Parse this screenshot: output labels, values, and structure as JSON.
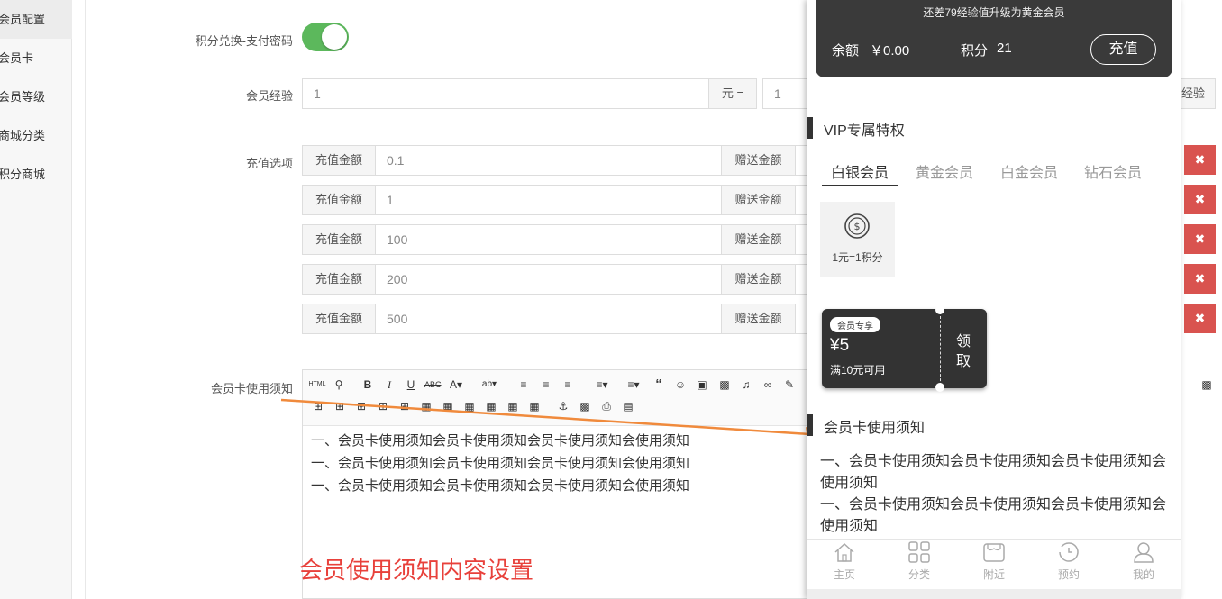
{
  "sidebar": {
    "items": [
      {
        "label": "会员配置",
        "active": true
      },
      {
        "label": "会员卡",
        "active": false
      },
      {
        "label": "会员等级",
        "active": false
      },
      {
        "label": "商城分类",
        "active": false
      },
      {
        "label": "积分商城",
        "active": false
      }
    ]
  },
  "form": {
    "points_pay_label": "积分兑换-支付密码",
    "points_pay_enabled": true,
    "exp_label": "会员经验",
    "exp_value": "1",
    "exp_unit": "元 =",
    "exp_value2": "1",
    "exp_suffix": "经验",
    "recharge_label": "充值选项",
    "recharge_rows": [
      {
        "amount_label": "充值金额",
        "amount": "0.1",
        "gift_label": "赠送金额"
      },
      {
        "amount_label": "充值金额",
        "amount": "1",
        "gift_label": "赠送金额"
      },
      {
        "amount_label": "充值金额",
        "amount": "100",
        "gift_label": "赠送金额"
      },
      {
        "amount_label": "充值金额",
        "amount": "200",
        "gift_label": "赠送金额"
      },
      {
        "amount_label": "充值金额",
        "amount": "500",
        "gift_label": "赠送金额"
      }
    ],
    "delete_glyph": "✖",
    "notice_label": "会员卡使用须知"
  },
  "editor": {
    "lines": [
      "一、会员卡使用须知会员卡使用须知会员卡使用须知会使用须知",
      "一、会员卡使用须知会员卡使用须知会员卡使用须知会使用须知",
      "一、会员卡使用须知会员卡使用须知会员卡使用须知会使用须知"
    ]
  },
  "annotation": {
    "text": "会员使用须知内容设置",
    "color": "#e8413b",
    "arrow_color": "#f08a3c"
  },
  "phone": {
    "upgrade_tip": "还差79经验值升级为黄金会员",
    "balance_label": "余额",
    "balance_value": "￥0.00",
    "points_label": "积分",
    "points_value": "21",
    "recharge_button": "充值",
    "vip_title": "VIP专属特权",
    "vip_tabs": [
      "白银会员",
      "黄金会员",
      "白金会员",
      "钻石会员"
    ],
    "privilege_label": "1元=1积分",
    "coupon": {
      "badge": "会员专享",
      "amount": "¥5",
      "condition": "满10元可用",
      "claim_1": "领",
      "claim_2": "取"
    },
    "notice_title": "会员卡使用须知",
    "notice_lines": [
      "一、会员卡使用须知会员卡使用须知会员卡使用须知会使用须知",
      "一、会员卡使用须知会员卡使用须知会员卡使用须知会使用须知"
    ],
    "nav": [
      {
        "label": "主页",
        "icon": "home-icon"
      },
      {
        "label": "分类",
        "icon": "grid-icon"
      },
      {
        "label": "附近",
        "icon": "store-icon"
      },
      {
        "label": "预约",
        "icon": "clock-icon"
      },
      {
        "label": "我的",
        "icon": "user-icon"
      }
    ]
  }
}
